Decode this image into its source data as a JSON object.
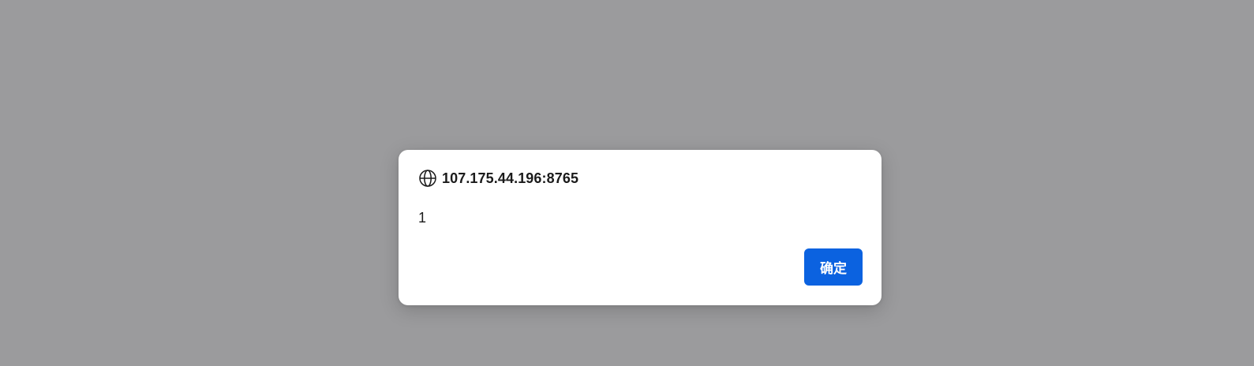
{
  "dialog": {
    "origin": "107.175.44.196:8765",
    "origin_icon": "globe-icon",
    "message": "1",
    "ok_label": "确定"
  },
  "colors": {
    "backdrop": "#9b9b9d",
    "dialog_bg": "#ffffff",
    "button_bg": "#0b62e0",
    "button_text": "#ffffff",
    "text": "#1b1b1b"
  }
}
